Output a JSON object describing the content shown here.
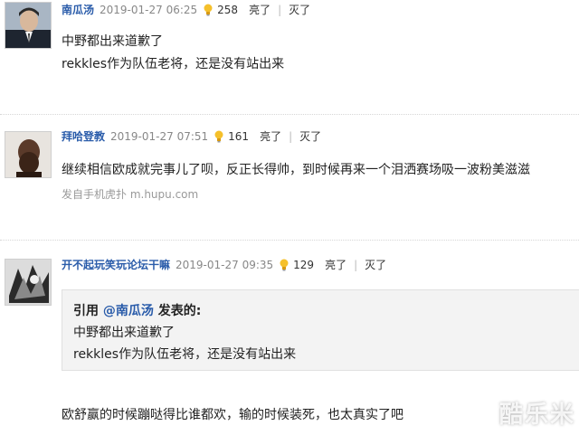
{
  "posts": [
    {
      "username": "南瓜汤",
      "time": "2019-01-27 06:25",
      "likes": "258",
      "light": "亮了",
      "dim": "灭了",
      "lines": [
        "中野都出来道歉了",
        "rekkles作为队伍老将，还是没有站出来"
      ]
    },
    {
      "username": "拜哈登教",
      "time": "2019-01-27 07:51",
      "likes": "161",
      "light": "亮了",
      "dim": "灭了",
      "lines": [
        "继续相信欧成就完事儿了呗，反正长得帅，到时候再来一个泪洒赛场吸一波粉美滋滋"
      ],
      "source": "发自手机虎扑 m.hupu.com"
    },
    {
      "username": "开不起玩笑玩论坛干嘛",
      "time": "2019-01-27 09:35",
      "likes": "129",
      "light": "亮了",
      "dim": "灭了",
      "quote": {
        "prefix": "引用",
        "name": "@南瓜汤",
        "suffix": "发表的:",
        "lines": [
          "中野都出来道歉了",
          "rekkles作为队伍老将，还是没有站出来"
        ]
      },
      "lines": [
        "欧舒赢的时候蹦哒得比谁都欢，输的时候装死，也太真实了吧"
      ]
    }
  ],
  "watermark": "酷乐米",
  "colors": {
    "username": "#2a5caa",
    "time": "#888888",
    "quote_bg": "#f3f3f3"
  }
}
